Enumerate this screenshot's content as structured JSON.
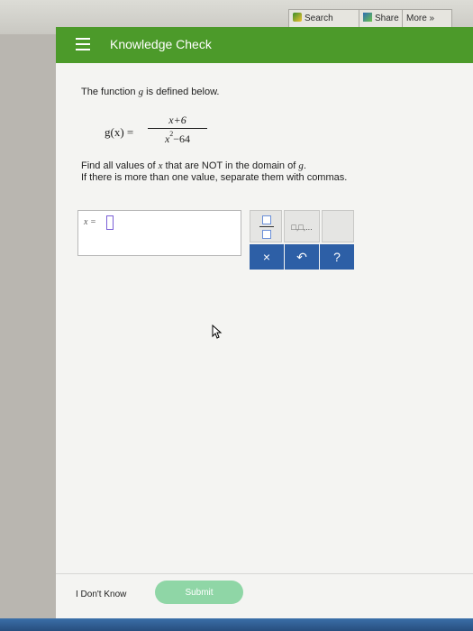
{
  "browser_toolbar": {
    "search_label": "Search",
    "share_label": "Share",
    "more_label": "More »"
  },
  "header": {
    "title": "Knowledge Check",
    "menu_icon": "hamburger-menu-icon",
    "bar_color": "#4c9a2a"
  },
  "question": {
    "intro_prefix": "The function ",
    "intro_var": "g",
    "intro_suffix": " is defined below.",
    "formula_lhs": "g(x) =",
    "formula_numerator": "x+6",
    "formula_den_var": "x",
    "formula_den_exp": "2",
    "formula_den_rest": "−64",
    "instruction_prefix": "Find all values of ",
    "instruction_var": "x",
    "instruction_middle": " that are NOT in the domain of ",
    "instruction_var2": "g",
    "instruction_suffix": ".",
    "instruction_line2": "If there is more than one value, separate them with commas."
  },
  "answer": {
    "label": "x =",
    "value": ""
  },
  "keypad": {
    "list_label": "□,□,...",
    "clear_label": "×",
    "undo_label": "↶",
    "help_label": "?",
    "button_color": "#2d5fa6"
  },
  "footer": {
    "dont_know_label": "I Don't Know",
    "submit_label": "Submit",
    "submit_color": "#8fd6a6"
  }
}
